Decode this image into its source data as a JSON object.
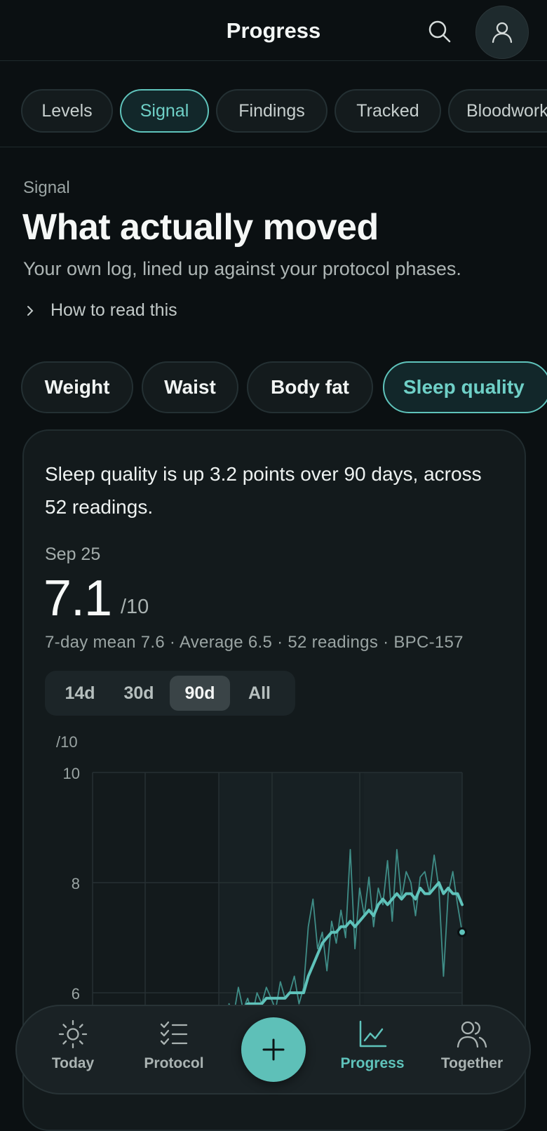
{
  "header": {
    "title": "Progress"
  },
  "tabs": [
    {
      "label": "Levels"
    },
    {
      "label": "Signal"
    },
    {
      "label": "Findings"
    },
    {
      "label": "Tracked"
    },
    {
      "label": "Bloodwork"
    }
  ],
  "intro": {
    "eyebrow": "Signal",
    "heading": "What actually moved",
    "subtitle": "Your own log, lined up against your protocol phases.",
    "how_to": "How to read this"
  },
  "metrics": [
    {
      "label": "Weight"
    },
    {
      "label": "Waist"
    },
    {
      "label": "Body fat"
    },
    {
      "label": "Sleep quality"
    }
  ],
  "card": {
    "summary": "Sleep quality is up 3.2 points over 90 days, across 52 readings.",
    "date": "Sep 25",
    "value": "7.1",
    "unit": "/10",
    "stats": "7-day mean 7.6 · Average 6.5 · 52 readings · BPC-157",
    "ranges": [
      {
        "label": "14d"
      },
      {
        "label": "30d"
      },
      {
        "label": "90d"
      },
      {
        "label": "All"
      }
    ],
    "selected_range": "90d"
  },
  "chart_data": {
    "type": "line",
    "unit_label": "/10",
    "ylim": [
      6,
      10
    ],
    "yticks": [
      "10",
      "8",
      "6"
    ],
    "series": [
      {
        "values": [
          5.5,
          5.8,
          5.6,
          6.1,
          5.7,
          5.9,
          5.6,
          6.0,
          5.8,
          6.1,
          5.9,
          5.7,
          6.2,
          5.9,
          6.0,
          6.3,
          5.8,
          6.1,
          7.2,
          7.7,
          6.8,
          7.1,
          6.4,
          7.3,
          6.9,
          7.5,
          7.0,
          8.6,
          6.8,
          7.9,
          7.4,
          8.1,
          7.2,
          7.9,
          7.6,
          8.4,
          7.3,
          8.6,
          7.7,
          8.2,
          8.0,
          7.4,
          8.1,
          8.2,
          7.8,
          8.5,
          7.9,
          6.3,
          7.8,
          8.2,
          7.6,
          7.1
        ]
      },
      {
        "values": [
          5.6,
          5.6,
          5.7,
          5.7,
          5.7,
          5.8,
          5.8,
          5.8,
          5.8,
          5.9,
          5.9,
          5.9,
          5.9,
          5.9,
          6.0,
          6.0,
          6.0,
          6.0,
          6.3,
          6.5,
          6.7,
          6.9,
          7.0,
          7.1,
          7.1,
          7.2,
          7.2,
          7.3,
          7.2,
          7.3,
          7.4,
          7.5,
          7.4,
          7.6,
          7.7,
          7.6,
          7.7,
          7.8,
          7.7,
          7.8,
          7.8,
          7.7,
          7.9,
          7.8,
          7.8,
          7.9,
          8.0,
          7.8,
          7.9,
          7.8,
          7.8,
          7.6
        ]
      }
    ],
    "last_point": {
      "y": 7.1
    },
    "colors": {
      "line": "#5fc3bb",
      "raw": "#3f8d87",
      "grid": "#263033",
      "band": "#172023"
    }
  },
  "nav": {
    "items": [
      {
        "label": "Today",
        "icon": "sun-icon"
      },
      {
        "label": "Protocol",
        "icon": "checklist-icon"
      },
      {
        "label": "Progress",
        "icon": "chart-icon"
      },
      {
        "label": "Together",
        "icon": "people-icon"
      }
    ],
    "active": "Progress"
  },
  "theme": {
    "accent": "#5fc3bb",
    "background": "#0b1012",
    "card": "#131a1c"
  }
}
